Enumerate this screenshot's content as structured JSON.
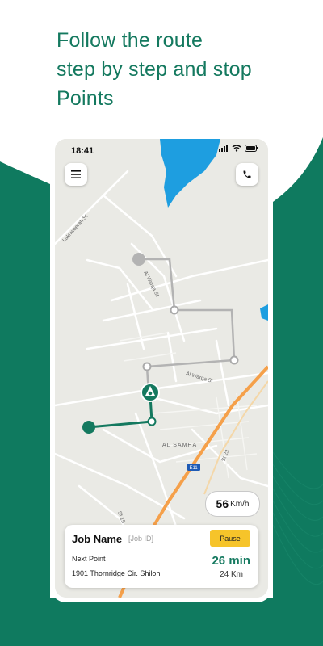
{
  "headline": {
    "line1": "Follow the route",
    "line2": "step by step and stop",
    "line3": "Points"
  },
  "colors": {
    "brand_green": "#14795f",
    "route_gray": "#b3b3b3",
    "pause_yellow": "#f6c42a",
    "water_blue": "#1e9ee0"
  },
  "status_bar": {
    "time": "18:41",
    "icons": [
      "signal-icon",
      "wifi-icon",
      "battery-icon"
    ]
  },
  "map": {
    "labels": {
      "street_lakhweerah": "Lakhweerah St",
      "street_alwarqa_1": "Al Warqa St",
      "street_alwarqa_2": "Al Warqa St",
      "district": "AL SAMHA",
      "road_e11": "E11",
      "street_15": "St 15",
      "street_23": "St 23"
    }
  },
  "speed": {
    "value": "56",
    "unit": "Km/h"
  },
  "job_card": {
    "title": "Job Name",
    "job_id": "[Job ID]",
    "pause_label": "Pause",
    "next_point_label": "Next Point",
    "next_point_address": "1901 Thornridge Cir. Shiloh",
    "eta_time": "26 min",
    "eta_distance": "24 Km"
  }
}
